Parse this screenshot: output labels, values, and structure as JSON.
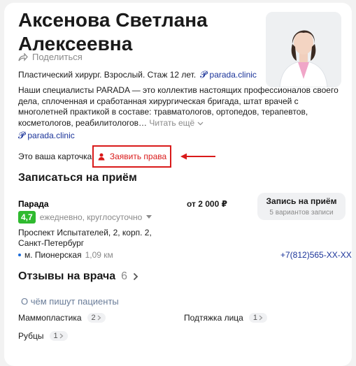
{
  "doctor": {
    "name_line1": "Аксенова Светлана",
    "name_line2": "Алексеевна",
    "share_label": "Поделиться",
    "meta_text": "Пластический хирург. Взрослый. Стаж 12 лет.",
    "meta_link": "parada.clinic",
    "description": "Наши специалисты PARADA — это коллектив настоящих профессионалов своего дела, сплоченная и сработанная хирургическая бригада, штат врачей с многолетней практикой в составе: травматологов, ортопедов, терапевтов, косметологов, реабилитологов…",
    "read_more": "Читать ещё",
    "desc_link": "parada.clinic"
  },
  "claim": {
    "question": "Это ваша карточка?",
    "button_label": "Заявить права"
  },
  "booking": {
    "title": "Записаться на приём",
    "clinic_name": "Парада",
    "rating": "4,7",
    "schedule": "ежедневно, круглосуточно",
    "price": "от 2 000 ₽",
    "button_title": "Запись на приём",
    "button_sub": "5 вариантов записи",
    "address_line1": "Проспект Испытателей, 2, корп. 2,",
    "address_line2": "Санкт-Петербург",
    "metro": "м. Пионерская",
    "metro_distance": "1,09 км",
    "phone": "+7(812)565-XX-XX"
  },
  "reviews": {
    "title": "Отзывы на врача",
    "count": "6",
    "subtitle": "О чём пишут пациенты",
    "tags": [
      {
        "label": "Маммопластика",
        "count": "2"
      },
      {
        "label": "Подтяжка лица",
        "count": "1"
      },
      {
        "label": "Рубцы",
        "count": "1"
      }
    ]
  },
  "colors": {
    "accent_red": "#d91a1a",
    "link_blue": "#1a3399",
    "rating_green": "#2fba2f"
  }
}
